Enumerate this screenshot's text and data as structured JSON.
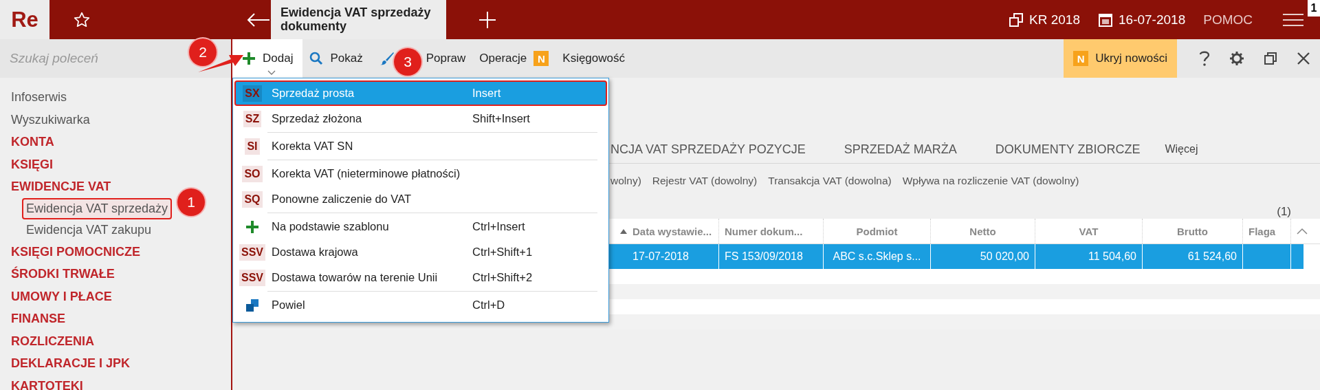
{
  "app": {
    "logo": "Re"
  },
  "tab": {
    "title": "Ewidencja VAT sprzedaży dokumenty"
  },
  "header_right": [
    {
      "kind": "period",
      "text": "KR 2018"
    },
    {
      "kind": "date",
      "text": "16-07-2018"
    },
    {
      "kind": "link",
      "text": "POMOC"
    }
  ],
  "corner_badge": "1",
  "search": {
    "placeholder": "Szukaj poleceń"
  },
  "toolbar": [
    {
      "kind": "add",
      "label": "Dodaj",
      "expanded": true
    },
    {
      "kind": "search",
      "label": "Pokaż",
      "expanded": false
    },
    {
      "kind": "edit",
      "label": "Popraw",
      "expanded": false
    },
    {
      "kind": "badge",
      "label": "Operacje",
      "badge": "N",
      "expanded": false
    },
    {
      "kind": "plain",
      "label": "Księgowość",
      "expanded": false
    }
  ],
  "news": {
    "badge": "N",
    "label": "Ukryj nowości"
  },
  "sidebar": [
    {
      "label": "Infoserwis",
      "kind": "link"
    },
    {
      "label": "Wyszukiwarka",
      "kind": "link"
    },
    {
      "label": "KONTA",
      "kind": "section"
    },
    {
      "label": "KSIĘGI",
      "kind": "section"
    },
    {
      "label": "EWIDENCJE VAT",
      "kind": "section",
      "children": [
        {
          "label": "Ewidencja VAT sprzedaży",
          "highlighted": true
        },
        {
          "label": "Ewidencja VAT zakupu",
          "highlighted": false
        }
      ]
    },
    {
      "label": "KSIĘGI POMOCNICZE",
      "kind": "section"
    },
    {
      "label": "ŚRODKI TRWAŁE",
      "kind": "section"
    },
    {
      "label": "UMOWY I PŁACE",
      "kind": "section"
    },
    {
      "label": "FINANSE",
      "kind": "section"
    },
    {
      "label": "ROZLICZENIA",
      "kind": "section"
    },
    {
      "label": "DEKLARACJE I JPK",
      "kind": "section"
    },
    {
      "label": "KARTOTEKI",
      "kind": "section"
    }
  ],
  "menu": {
    "groups": [
      [
        {
          "kind": "code",
          "code": "SX",
          "label": "Sprzedaż prosta",
          "shortcut": "Insert",
          "selected": true
        },
        {
          "kind": "code",
          "code": "SZ",
          "label": "Sprzedaż złożona",
          "shortcut": "Shift+Insert",
          "selected": false
        }
      ],
      [
        {
          "kind": "code",
          "code": "SI",
          "label": "Korekta VAT SN",
          "selected": false
        }
      ],
      [
        {
          "kind": "code",
          "code": "SO",
          "label": "Korekta VAT (nieterminowe płatności)",
          "selected": false
        },
        {
          "kind": "code",
          "code": "SQ",
          "label": "Ponowne zaliczenie do VAT",
          "selected": false
        }
      ],
      [
        {
          "kind": "plus",
          "label": "Na podstawie szablonu",
          "shortcut": "Ctrl+Insert",
          "selected": false
        },
        {
          "kind": "code",
          "code": "SSV",
          "label": "Dostawa krajowa",
          "shortcut": "Ctrl+Shift+1",
          "selected": false
        },
        {
          "kind": "code",
          "code": "SSV",
          "label": "Dostawa towarów na terenie Unii",
          "shortcut": "Ctrl+Shift+2",
          "selected": false
        }
      ],
      [
        {
          "kind": "copy",
          "label": "Powiel",
          "shortcut": "Ctrl+D",
          "selected": false
        }
      ]
    ]
  },
  "content_tabs": [
    {
      "label": "NCJA VAT SPRZEDAŻY POZYCJE",
      "kind": "upper"
    },
    {
      "label": "SPRZEDAŻ MARŻA",
      "kind": "upper"
    },
    {
      "label": "DOKUMENTY ZBIORCZE",
      "kind": "upper"
    },
    {
      "label": "Więcej",
      "kind": "more"
    }
  ],
  "filters": [
    "wolny)",
    "Rejestr VAT (dowolny)",
    "Transakcja VAT (dowolna)",
    "Wpływa na rozliczenie VAT (dowolny)"
  ],
  "count": "(1)",
  "table": {
    "columns": [
      {
        "label": "Data wystawie...",
        "sorted": true
      },
      {
        "label": "Numer dokum...",
        "sorted": false
      },
      {
        "label": "Podmiot",
        "sorted": false
      },
      {
        "label": "Netto",
        "sorted": false
      },
      {
        "label": "VAT",
        "sorted": false
      },
      {
        "label": "Brutto",
        "sorted": false
      },
      {
        "label": "Flaga",
        "sorted": false
      }
    ],
    "rows": [
      {
        "selected": true,
        "cells": [
          "17-07-2018",
          "FS 153/09/2018",
          "ABC s.c.Sklep s...",
          "50 020,00",
          "11 504,60",
          "61 524,60",
          ""
        ]
      }
    ]
  },
  "callouts": [
    "1",
    "2",
    "3"
  ]
}
